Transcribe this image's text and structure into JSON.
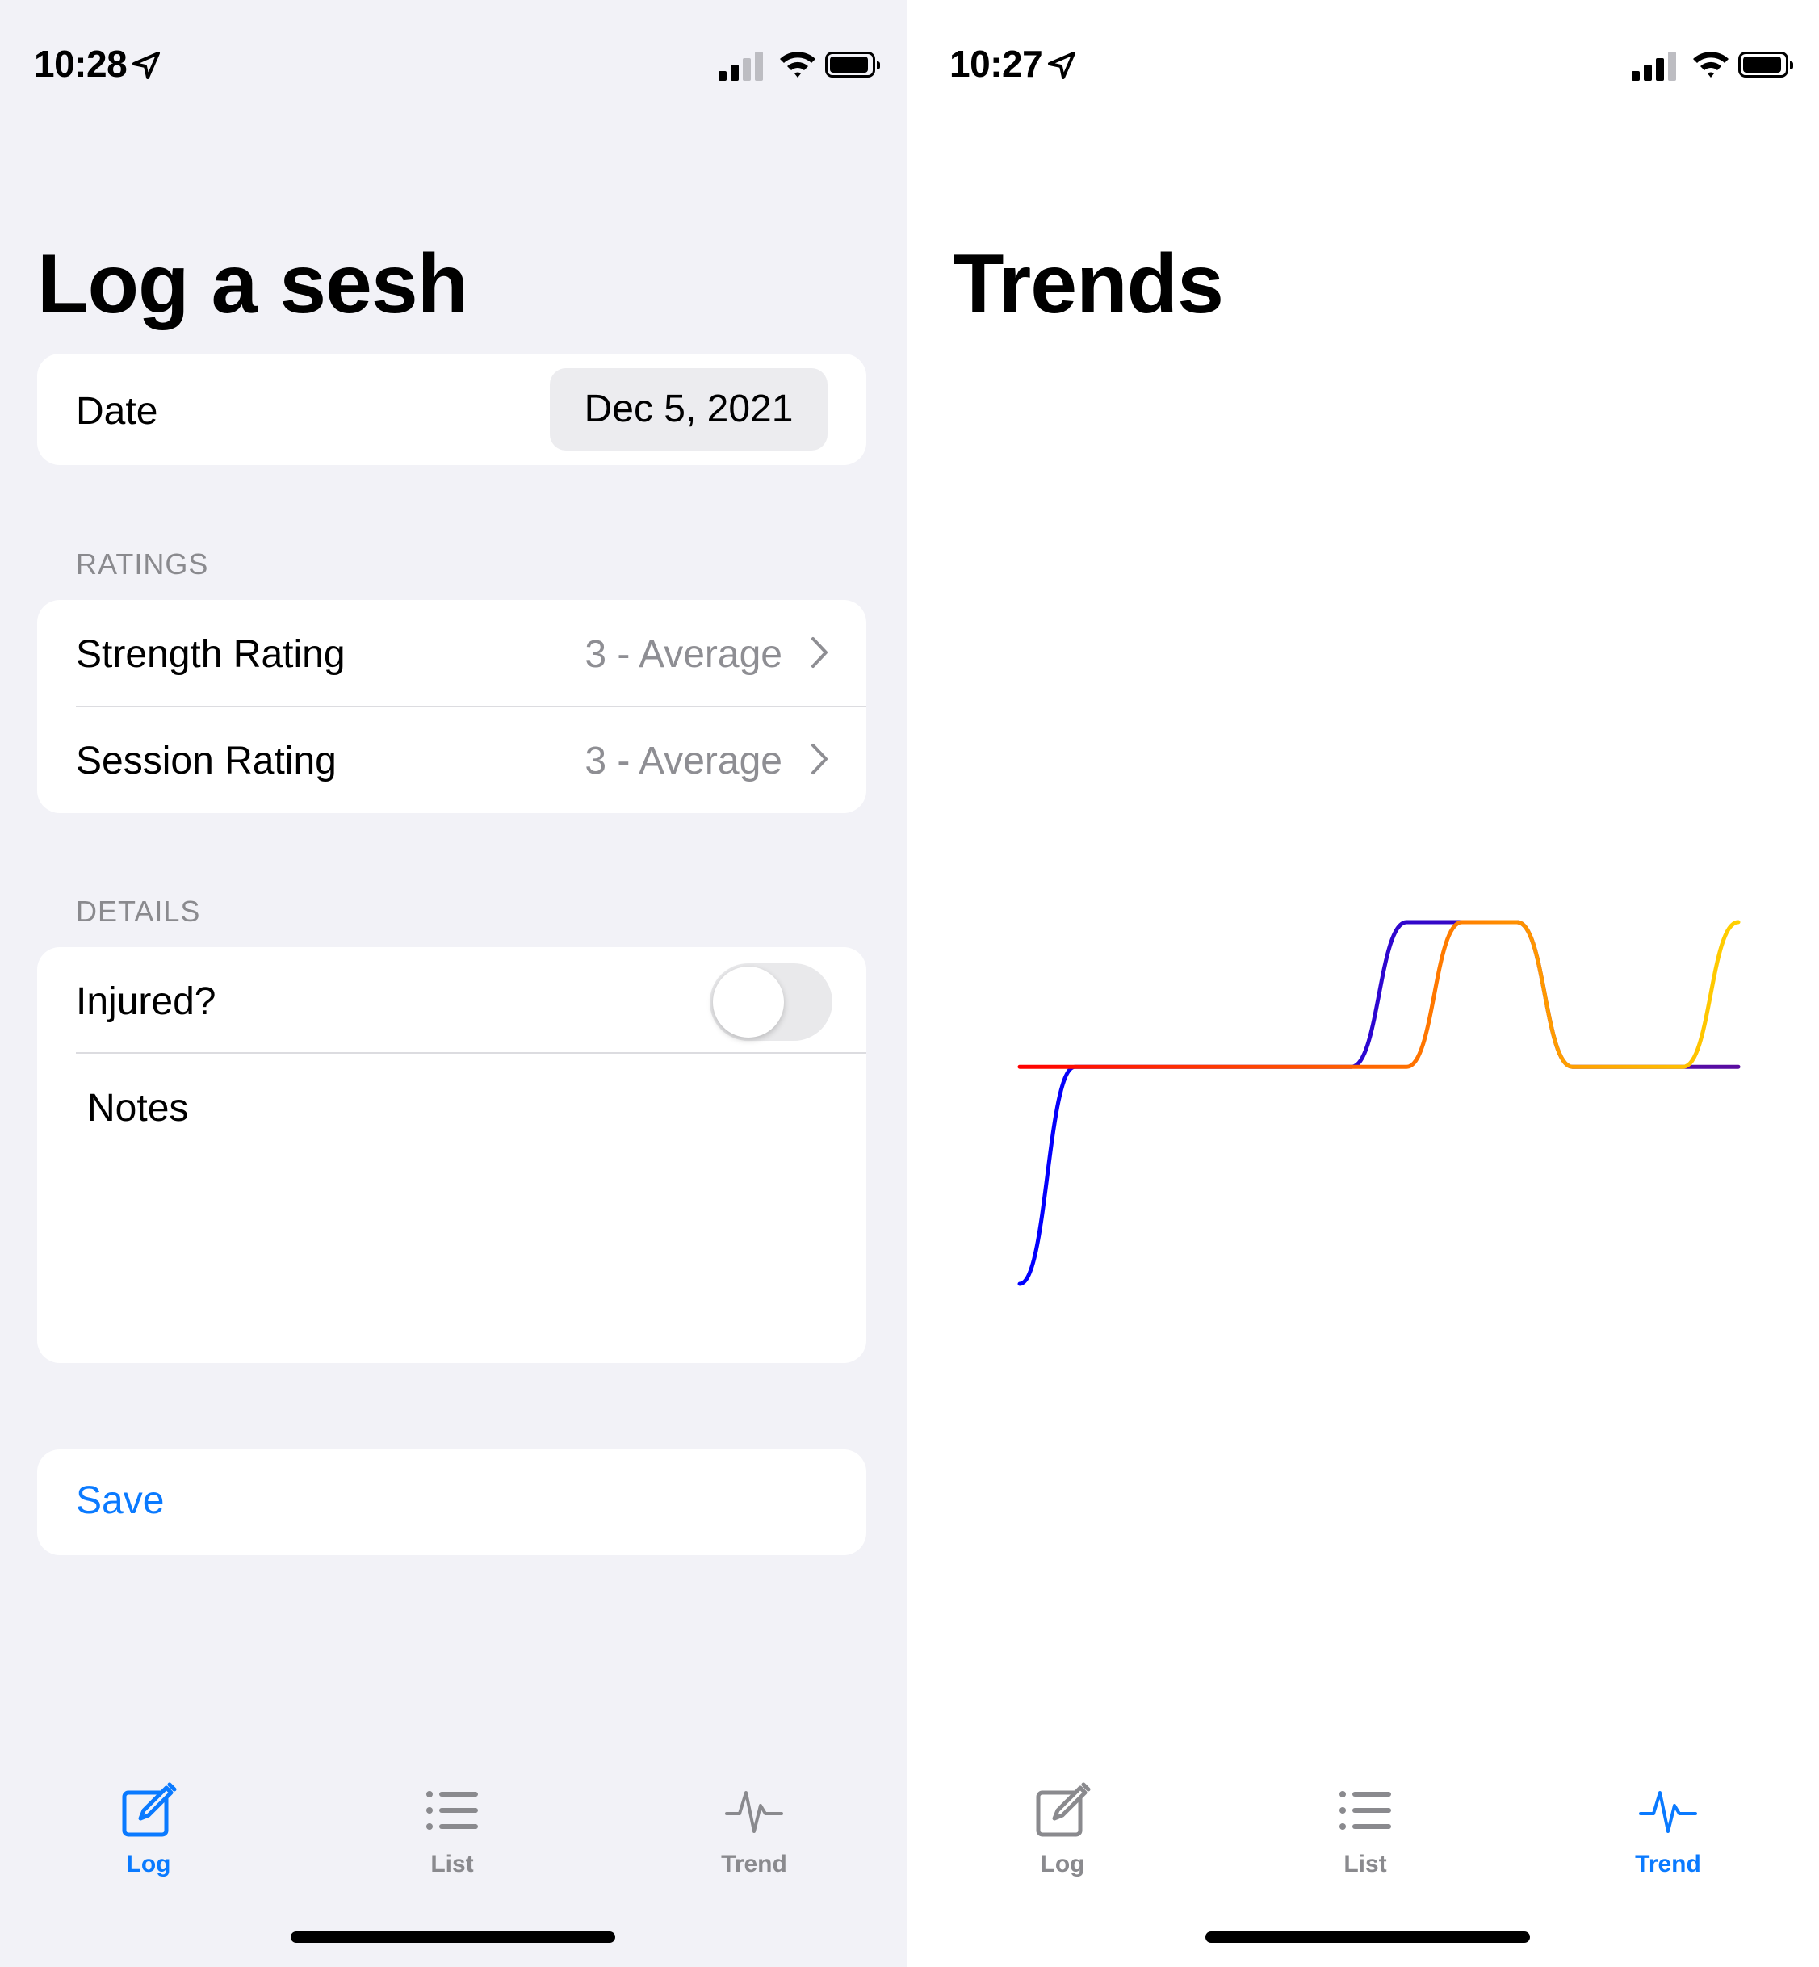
{
  "log_screen": {
    "status": {
      "time": "10:28"
    },
    "title": "Log a sesh",
    "date": {
      "label": "Date",
      "value": "Dec 5, 2021"
    },
    "ratings": {
      "header": "RATINGS",
      "strength": {
        "label": "Strength Rating",
        "value": "3 - Average"
      },
      "session": {
        "label": "Session Rating",
        "value": "3 - Average"
      }
    },
    "details": {
      "header": "DETAILS",
      "injured": {
        "label": "Injured?",
        "on": false
      },
      "notes_placeholder": "Notes"
    },
    "save_label": "Save",
    "active_tab": "Log"
  },
  "trends_screen": {
    "status": {
      "time": "10:27"
    },
    "title": "Trends",
    "active_tab": "Trend"
  },
  "tabs": [
    {
      "label": "Log",
      "icon": "square-and-pencil-icon"
    },
    {
      "label": "List",
      "icon": "list-bullet-icon"
    },
    {
      "label": "Trend",
      "icon": "waveform-path-ecg-icon"
    }
  ],
  "colors": {
    "accent": "#0a7aff",
    "inactive": "#8a8a8e",
    "grouped_background": "#f2f2f7"
  },
  "chart_data": {
    "type": "line",
    "title": "",
    "xlabel": "",
    "ylabel": "",
    "axes_visible": false,
    "grid": false,
    "legend": "none",
    "x": [
      1,
      2,
      3,
      4,
      5,
      6,
      7,
      8,
      9,
      10,
      11,
      12,
      13,
      14
    ],
    "ylim": [
      0,
      5
    ],
    "series": [
      {
        "color_start": "#0000ff",
        "color_end": "#5a0ca0",
        "values": [
          0,
          3,
          3,
          3,
          3,
          3,
          3,
          5,
          5,
          5,
          3,
          3,
          3,
          3
        ]
      },
      {
        "color_start": "#ff0000",
        "color_end": "#ffd000",
        "values": [
          3,
          3,
          3,
          3,
          3,
          3,
          3,
          3,
          5,
          5,
          3,
          3,
          3,
          5
        ]
      }
    ]
  }
}
